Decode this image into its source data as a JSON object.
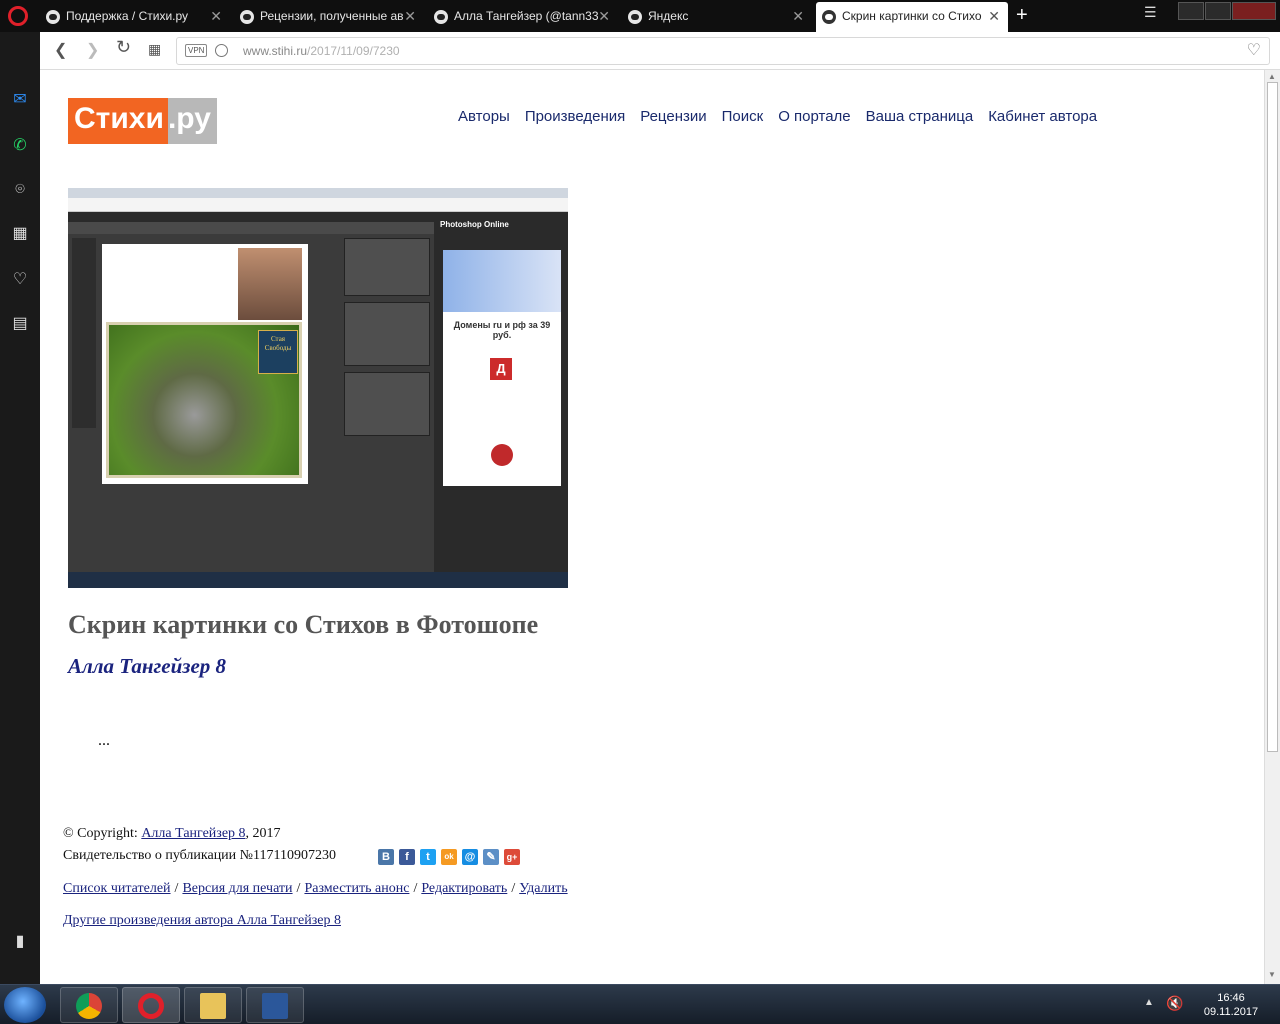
{
  "browser": {
    "tabs": [
      {
        "label": "Поддержка / Стихи.ру"
      },
      {
        "label": "Рецензии, полученные ав"
      },
      {
        "label": "Алла Тангейзер (@tann33"
      },
      {
        "label": "Яндекс"
      },
      {
        "label": "Скрин картинки со Стихо"
      }
    ],
    "url_host": "www.stihi.ru",
    "url_path": "/2017/11/09/7230",
    "vpn_label": "VPN"
  },
  "site": {
    "logo_main": "Стихи",
    "logo_suffix": ".ру",
    "logo_colors": {
      "orange": "#f26522",
      "gray": "#b8b8b8"
    },
    "nav": [
      "Авторы",
      "Произведения",
      "Рецензии",
      "Поиск",
      "О портале",
      "Ваша страница",
      "Кабинет автора"
    ]
  },
  "work": {
    "title": "Скрин картинки со Стихов в Фотошопе",
    "author": "Алла Тангейзер 8",
    "body": "...",
    "image": {
      "app_title": "Photoshop Online",
      "ad_text": "Домены ru и рф за 39 руб.",
      "ad_letter": "Д",
      "book_text": "Стая Свободы"
    }
  },
  "footer": {
    "copyright_prefix": "© Copyright: ",
    "copyright_author": "Алла Тангейзер 8",
    "copyright_year": ", 2017",
    "certificate": "Свидетельство о публикации №117110907230",
    "social": [
      {
        "name": "vk",
        "glyph": "B",
        "color": "#4a76a8"
      },
      {
        "name": "facebook",
        "glyph": "f",
        "color": "#3b5998"
      },
      {
        "name": "twitter",
        "glyph": "t",
        "color": "#1da1f2"
      },
      {
        "name": "odnoklassniki",
        "glyph": "ok",
        "color": "#f59a22"
      },
      {
        "name": "mail",
        "glyph": "@",
        "color": "#168de2"
      },
      {
        "name": "livejournal",
        "glyph": "✎",
        "color": "#5c8fc6"
      },
      {
        "name": "google-plus",
        "glyph": "g+",
        "color": "#dd4b39"
      }
    ],
    "links": [
      "Список читателей",
      "Версия для печати",
      "Разместить анонс",
      "Редактировать",
      "Удалить"
    ],
    "other_works": "Другие произведения автора Алла Тангейзер 8"
  },
  "taskbar": {
    "time": "16:46",
    "date": "09.11.2017"
  }
}
